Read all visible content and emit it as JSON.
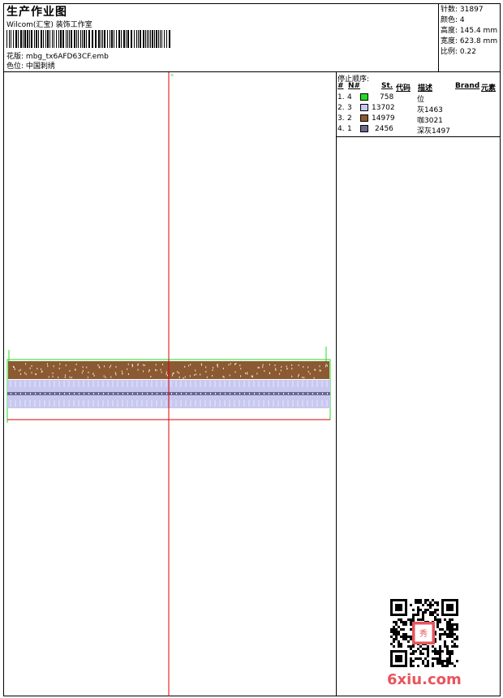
{
  "header": {
    "title": "生产作业图",
    "company": "Wilcom(汇宝) 装饰工作室",
    "pattern_label": "花版:",
    "pattern_value": "mbg_tx6AFD63CF.emb",
    "color_label": "色位:",
    "color_value": "中国刺绣"
  },
  "stats": {
    "stitches_label": "针数:",
    "stitches_value": "31897",
    "colors_label": "颜色:",
    "colors_value": "4",
    "height_label": "高度:",
    "height_value": "145.4 mm",
    "width_label": "宽度:",
    "width_value": "623.8 mm",
    "scale_label": "比例:",
    "scale_value": "0.22"
  },
  "stop_sequence": {
    "title": "停止顺序:",
    "columns": [
      "#",
      "N#",
      "St.",
      "代码",
      "描述",
      "Brand",
      "元素"
    ],
    "rows": [
      {
        "seq": "1.",
        "n": "4",
        "code": "758",
        "desc": "位",
        "color": "#22dd22"
      },
      {
        "seq": "2.",
        "n": "3",
        "code": "13702",
        "desc": "灰1463",
        "color": "#c8c8f0"
      },
      {
        "seq": "3.",
        "n": "2",
        "code": "14979",
        "desc": "咖3021",
        "color": "#8b5a32"
      },
      {
        "seq": "4.",
        "n": "1",
        "code": "2456",
        "desc": "深灰1497",
        "color": "#6a6a90"
      }
    ]
  },
  "colors": {
    "brown": "#8b5a32",
    "lavender": "#c8c8f0",
    "dark_slate": "#6a6a90",
    "green": "#22dd22",
    "red_axis": "#dd0000",
    "logo": "#e8555c"
  },
  "logo": {
    "text": "6xiu.com"
  }
}
